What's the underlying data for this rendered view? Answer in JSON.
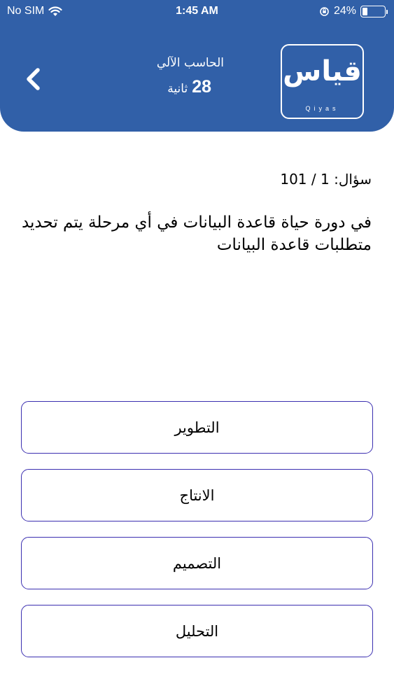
{
  "status_bar": {
    "carrier": "No SIM",
    "time": "1:45 AM",
    "battery_percent": "24%",
    "battery_level": 0.24
  },
  "header": {
    "subject": "الحاسب الآلي",
    "timer_value": "28",
    "timer_unit": "ثانية",
    "logo_text": "قياس",
    "logo_latin": "Qiyas",
    "background_color": "#3160a8"
  },
  "question": {
    "counter": "سؤال: 1 / 101",
    "text": "في دورة حياة قاعدة البيانات في أي مرحلة يتم تحديد متطلبات قاعدة البيانات"
  },
  "options": [
    {
      "label": "التطوير"
    },
    {
      "label": "الانتاج"
    },
    {
      "label": "التصميم"
    },
    {
      "label": "التحليل"
    }
  ],
  "colors": {
    "option_border": "#3b2fb0"
  }
}
